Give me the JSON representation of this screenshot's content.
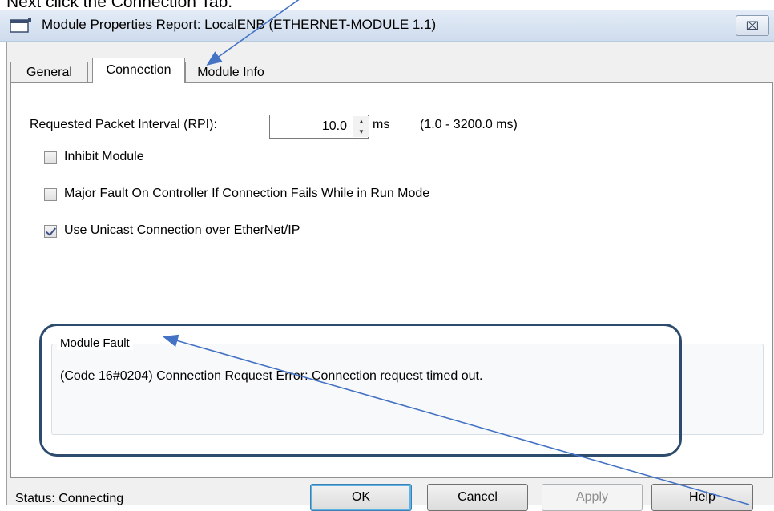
{
  "caption": "Next click the Connection Tab.",
  "window": {
    "title": "Module Properties Report: LocalENB (ETHERNET-MODULE 1.1)",
    "close_glyph": "⌧"
  },
  "tabs": [
    {
      "label": "General",
      "active": false
    },
    {
      "label": "Connection",
      "active": true
    },
    {
      "label": "Module Info",
      "active": false
    }
  ],
  "rpi": {
    "label": "Requested Packet Interval (RPI):",
    "value": "10.0",
    "unit": "ms",
    "range": "(1.0 - 3200.0 ms)"
  },
  "options": [
    {
      "label": "Inhibit Module",
      "checked": false
    },
    {
      "label": "Major Fault On Controller If Connection Fails While in Run Mode",
      "checked": false
    },
    {
      "label": "Use Unicast Connection over EtherNet/IP",
      "checked": true
    }
  ],
  "module_fault": {
    "legend": "Module Fault",
    "message": "(Code 16#0204) Connection Request Error: Connection request timed out."
  },
  "status": {
    "text": "Status:  Connecting"
  },
  "buttons": {
    "ok": "OK",
    "cancel": "Cancel",
    "apply": "Apply",
    "help": "Help"
  },
  "colors": {
    "annotation_arrow": "#4472c4",
    "highlight_border": "#2d4c6d"
  }
}
